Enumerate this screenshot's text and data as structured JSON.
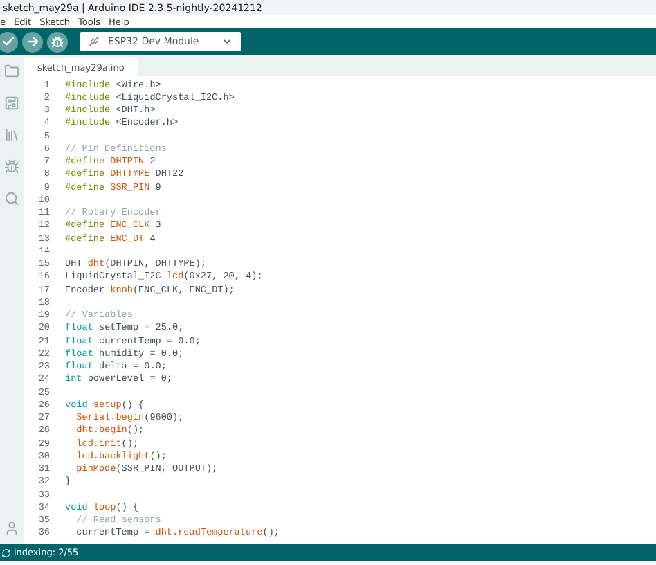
{
  "window": {
    "title": "sketch_may29a | Arduino IDE 2.3.5-nightly-20241212"
  },
  "menu": [
    "e",
    "Edit",
    "Sketch",
    "Tools",
    "Help"
  ],
  "toolbar": {
    "board": "ESP32 Dev Module"
  },
  "tabs": [
    {
      "label": "sketch_may29a.ino",
      "selected": true
    }
  ],
  "code": [
    {
      "n": "1",
      "tokens": [
        {
          "kind": "pp",
          "text": "#include"
        },
        {
          "kind": "tx",
          "text": " <Wire.h>"
        }
      ]
    },
    {
      "n": "2",
      "tokens": [
        {
          "kind": "pp",
          "text": "#include"
        },
        {
          "kind": "tx",
          "text": " <LiquidCrystal_I2C.h>"
        }
      ]
    },
    {
      "n": "3",
      "tokens": [
        {
          "kind": "pp",
          "text": "#include"
        },
        {
          "kind": "tx",
          "text": " <DHT.h>"
        }
      ]
    },
    {
      "n": "4",
      "tokens": [
        {
          "kind": "pp",
          "text": "#include"
        },
        {
          "kind": "tx",
          "text": " <Encoder.h>"
        }
      ]
    },
    {
      "n": "5"
    },
    {
      "n": "6",
      "tokens": [
        {
          "kind": "cm",
          "text": "// Pin Definitions"
        }
      ]
    },
    {
      "n": "7",
      "tokens": [
        {
          "kind": "pp",
          "text": "#define"
        },
        {
          "kind": "fn",
          "text": " DHTPIN"
        },
        {
          "kind": "tx",
          "text": " 2"
        }
      ]
    },
    {
      "n": "8",
      "tokens": [
        {
          "kind": "pp",
          "text": "#define"
        },
        {
          "kind": "fn",
          "text": " DHTTYPE"
        },
        {
          "kind": "tx",
          "text": " DHT22"
        }
      ]
    },
    {
      "n": "9",
      "tokens": [
        {
          "kind": "pp",
          "text": "#define"
        },
        {
          "kind": "fn",
          "text": " SSR_PIN"
        },
        {
          "kind": "tx",
          "text": " 9"
        }
      ]
    },
    {
      "n": "10"
    },
    {
      "n": "11",
      "tokens": [
        {
          "kind": "cm",
          "text": "// Rotary Encoder"
        }
      ]
    },
    {
      "n": "12",
      "tokens": [
        {
          "kind": "pp",
          "text": "#define"
        },
        {
          "kind": "fn",
          "text": " ENC_CLK"
        },
        {
          "kind": "tx",
          "text": " 3"
        }
      ]
    },
    {
      "n": "13",
      "tokens": [
        {
          "kind": "pp",
          "text": "#define"
        },
        {
          "kind": "fn",
          "text": " ENC_DT"
        },
        {
          "kind": "tx",
          "text": " 4"
        }
      ]
    },
    {
      "n": "14"
    },
    {
      "n": "15",
      "tokens": [
        {
          "kind": "tx",
          "text": "DHT "
        },
        {
          "kind": "fn",
          "text": "dht"
        },
        {
          "kind": "tx",
          "text": "(DHTPIN, DHTTYPE);"
        }
      ]
    },
    {
      "n": "16",
      "tokens": [
        {
          "kind": "tx",
          "text": "LiquidCrystal_I2C "
        },
        {
          "kind": "fn",
          "text": "lcd"
        },
        {
          "kind": "tx",
          "text": "(0x27, 20, 4);"
        }
      ]
    },
    {
      "n": "17",
      "tokens": [
        {
          "kind": "tx",
          "text": "Encoder "
        },
        {
          "kind": "fn",
          "text": "knob"
        },
        {
          "kind": "tx",
          "text": "(ENC_CLK, ENC_DT);"
        }
      ]
    },
    {
      "n": "18"
    },
    {
      "n": "19",
      "tokens": [
        {
          "kind": "cm",
          "text": "// Variables"
        }
      ]
    },
    {
      "n": "20",
      "tokens": [
        {
          "kind": "kw",
          "text": "float"
        },
        {
          "kind": "tx",
          "text": " setTemp = 25.0;"
        }
      ]
    },
    {
      "n": "21",
      "tokens": [
        {
          "kind": "kw",
          "text": "float"
        },
        {
          "kind": "tx",
          "text": " currentTemp = 0.0;"
        }
      ]
    },
    {
      "n": "22",
      "tokens": [
        {
          "kind": "kw",
          "text": "float"
        },
        {
          "kind": "tx",
          "text": " humidity = 0.0;"
        }
      ]
    },
    {
      "n": "23",
      "tokens": [
        {
          "kind": "kw",
          "text": "float"
        },
        {
          "kind": "tx",
          "text": " delta = 0.0;"
        }
      ]
    },
    {
      "n": "24",
      "tokens": [
        {
          "kind": "kw",
          "text": "int"
        },
        {
          "kind": "tx",
          "text": " powerLevel = 0;"
        }
      ]
    },
    {
      "n": "25"
    },
    {
      "n": "26",
      "tokens": [
        {
          "kind": "kw",
          "text": "void"
        },
        {
          "kind": "fn",
          "text": " setup"
        },
        {
          "kind": "tx",
          "text": "() {"
        }
      ]
    },
    {
      "n": "27",
      "tokens": [
        {
          "kind": "fn",
          "text": "  Serial.begin"
        },
        {
          "kind": "tx",
          "text": "(9600);"
        }
      ]
    },
    {
      "n": "28",
      "tokens": [
        {
          "kind": "fn",
          "text": "  dht.begin"
        },
        {
          "kind": "tx",
          "text": "();"
        }
      ]
    },
    {
      "n": "29",
      "tokens": [
        {
          "kind": "fn",
          "text": "  lcd.init"
        },
        {
          "kind": "tx",
          "text": "();"
        }
      ]
    },
    {
      "n": "30",
      "tokens": [
        {
          "kind": "fn",
          "text": "  lcd.backlight"
        },
        {
          "kind": "tx",
          "text": "();"
        }
      ]
    },
    {
      "n": "31",
      "tokens": [
        {
          "kind": "fn",
          "text": "  pinMode"
        },
        {
          "kind": "tx",
          "text": "(SSR_PIN, OUTPUT);"
        }
      ]
    },
    {
      "n": "32",
      "tokens": [
        {
          "kind": "tx",
          "text": "}"
        }
      ]
    },
    {
      "n": "33"
    },
    {
      "n": "34",
      "tokens": [
        {
          "kind": "kw",
          "text": "void"
        },
        {
          "kind": "fn",
          "text": " loop"
        },
        {
          "kind": "tx",
          "text": "() {"
        }
      ]
    },
    {
      "n": "35",
      "tokens": [
        {
          "kind": "cm",
          "text": "  // Read sensors"
        }
      ]
    },
    {
      "n": "36",
      "tokens": [
        {
          "kind": "tx",
          "text": "  currentTemp = "
        },
        {
          "kind": "fn",
          "text": "dht.readTemperature"
        },
        {
          "kind": "tx",
          "text": "();"
        }
      ]
    }
  ],
  "status_bar": {
    "text": "indexing: 2/55"
  }
}
